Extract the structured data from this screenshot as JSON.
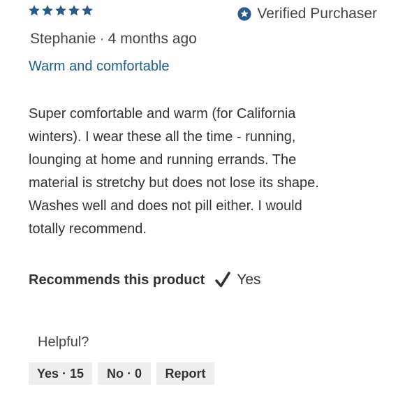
{
  "review": {
    "rating": 5,
    "rating_max": 5,
    "star_color": "#2a5a8c",
    "verified_label": "Verified Purchaser",
    "verified_icon": "star-badge-icon",
    "accent_color": "#2a5a8c",
    "author": "Stephanie",
    "separator": "·",
    "posted": "4 months ago",
    "title": "Warm and comfortable",
    "title_color": "#1a5e8e",
    "body": "Super comfortable and warm (for California winters). I wear these all the time - running, lounging at home and running errands. The material is stretchy but does not lose its shape. Washes well and does not pill either. I would totally recommend.",
    "recommends_label": "Recommends this product",
    "recommends_icon": "checkmark-icon",
    "recommends_value": "Yes"
  },
  "feedback": {
    "helpful_label": "Helpful?",
    "yes_button": "Yes · 15",
    "no_button": "No · 0",
    "report_button": "Report"
  }
}
